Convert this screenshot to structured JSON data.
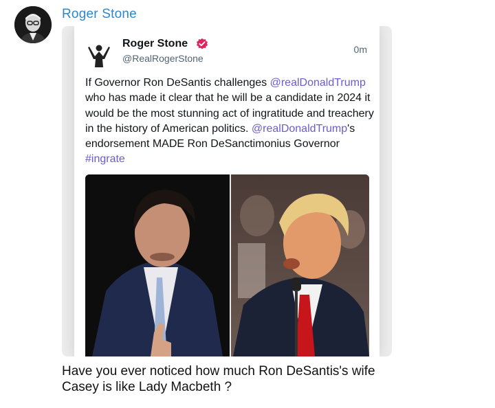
{
  "message": {
    "poster_name": "Roger Stone",
    "caption": "Have you ever noticed how much Ron DeSantis's wife Casey is like Lady Macbeth ?"
  },
  "tweet": {
    "display_name": "Roger Stone",
    "handle": "@RealRogerStone",
    "time": "0m",
    "text_parts": [
      "If Governor Ron DeSantis challenges ",
      "@realDonaldTrump",
      " who has made it clear that he will be a candidate in 2024 it would be the most stunning act of ingratitude and treachery in the history of American politics. ",
      "@realDonaldTrump",
      "'s endorsement MADE Ron DeSanctimonius Governor ",
      "#ingrate"
    ]
  },
  "colors": {
    "poster_name": "#2f86c9",
    "link": "#6a5ccf",
    "verified": "#e0245e"
  }
}
